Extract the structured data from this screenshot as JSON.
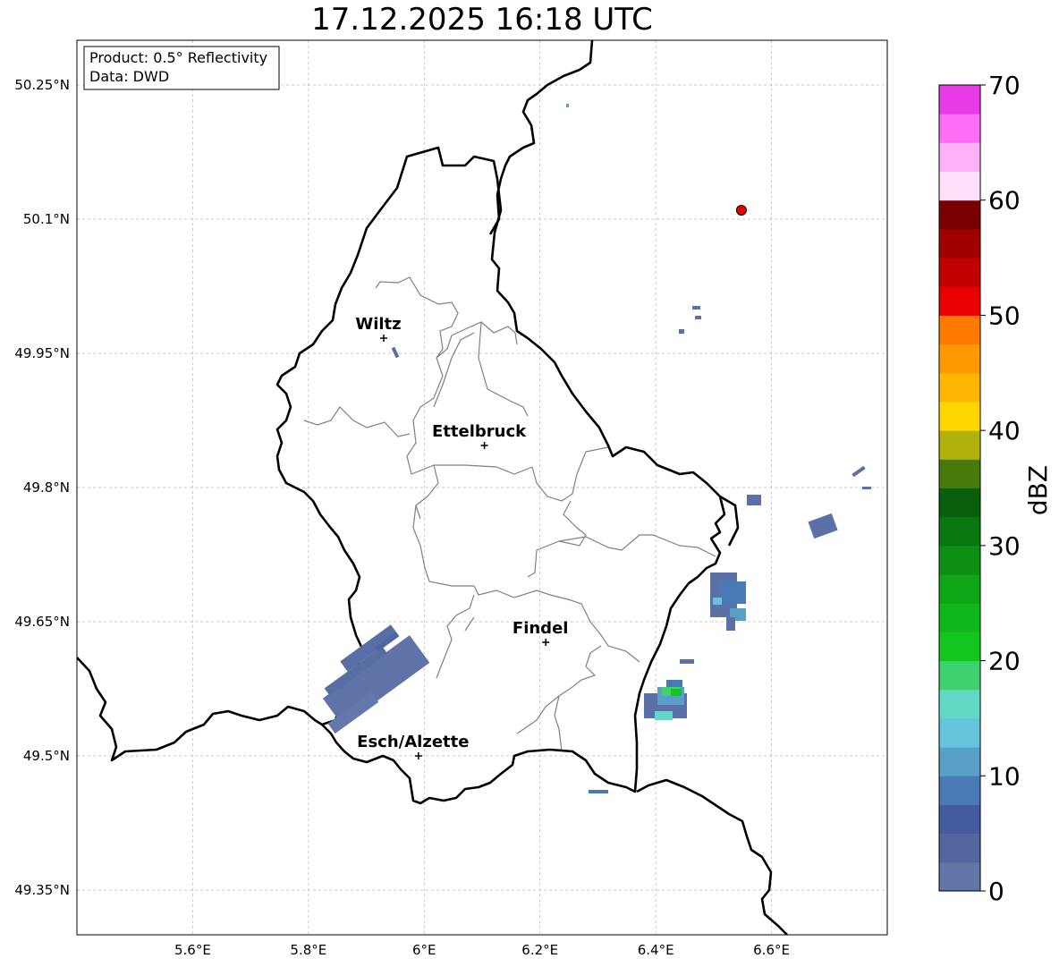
{
  "title": "17.12.2025 16:18 UTC",
  "info_box": {
    "line1": "Product: 0.5° Reflectivity",
    "line2": "Data: DWD"
  },
  "axes": {
    "lon_range": [
      5.4,
      6.8
    ],
    "lat_range": [
      49.3,
      50.3
    ],
    "x_ticks": [
      {
        "value": 5.6,
        "label": "5.6°E"
      },
      {
        "value": 5.8,
        "label": "5.8°E"
      },
      {
        "value": 6.0,
        "label": "6°E"
      },
      {
        "value": 6.2,
        "label": "6.2°E"
      },
      {
        "value": 6.4,
        "label": "6.4°E"
      },
      {
        "value": 6.6,
        "label": "6.6°E"
      }
    ],
    "y_ticks": [
      {
        "value": 50.25,
        "label": "50.25°N"
      },
      {
        "value": 50.1,
        "label": "50.1°N"
      },
      {
        "value": 49.95,
        "label": "49.95°N"
      },
      {
        "value": 49.8,
        "label": "49.8°N"
      },
      {
        "value": 49.65,
        "label": "49.65°N"
      },
      {
        "value": 49.5,
        "label": "49.5°N"
      },
      {
        "value": 49.35,
        "label": "49.35°N"
      }
    ]
  },
  "cities": [
    {
      "name": "Wiltz",
      "lon": 5.93,
      "lat": 49.967
    },
    {
      "name": "Ettelbruck",
      "lon": 6.104,
      "lat": 49.847
    },
    {
      "name": "Findel",
      "lon": 6.21,
      "lat": 49.627
    },
    {
      "name": "Esch/Alzette",
      "lon": 5.99,
      "lat": 49.5
    }
  ],
  "radar_site": {
    "lon": 6.548,
    "lat": 50.11,
    "color": "#e80000"
  },
  "colorbar": {
    "label": "dBZ",
    "min": 0,
    "max": 70,
    "step": 2.5,
    "tick_values": [
      0,
      10,
      20,
      30,
      40,
      50,
      60,
      70
    ],
    "colors": [
      "#6475a8",
      "#53659e",
      "#425ba1",
      "#4a7ab5",
      "#58a0c8",
      "#66c4dd",
      "#60d8c4",
      "#3dd26f",
      "#13c61e",
      "#10b71a",
      "#0ea516",
      "#0c8f12",
      "#0a7811",
      "#085f0c",
      "#477a0a",
      "#b0b10a",
      "#ffd600",
      "#ffb703",
      "#ff9900",
      "#ff7800",
      "#e80000",
      "#c30000",
      "#a00000",
      "#780000",
      "#ffe0fa",
      "#ffb0f8",
      "#ff6cf5",
      "#e83be8"
    ]
  },
  "colors": {
    "border": "#000000",
    "canton": "#808080",
    "grid": "#b8b8b8"
  }
}
